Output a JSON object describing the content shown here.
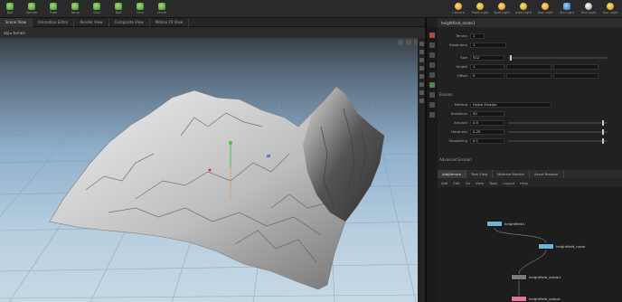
{
  "shelf": {
    "tools": [
      {
        "label": "Box",
        "icon": "box-icon",
        "color": "green"
      },
      {
        "label": "Sphere",
        "icon": "sphere-icon",
        "color": "green"
      },
      {
        "label": "Tube",
        "icon": "tube-icon",
        "color": "green"
      },
      {
        "label": "Torus",
        "icon": "torus-icon",
        "color": "green"
      },
      {
        "label": "Grid",
        "icon": "grid-icon",
        "color": "green"
      },
      {
        "label": "Null",
        "icon": "null-icon",
        "color": "green"
      },
      {
        "label": "Line",
        "icon": "line-icon",
        "color": "green"
      },
      {
        "label": "Circle",
        "icon": "circle-icon",
        "color": "green"
      }
    ],
    "right_tools": [
      {
        "label": "Camera",
        "icon": "camera-icon",
        "color": "yellow"
      },
      {
        "label": "Point Light",
        "icon": "point-light-icon",
        "color": "yellow"
      },
      {
        "label": "Spot Light",
        "icon": "spot-light-icon",
        "color": "yellow"
      },
      {
        "label": "Area Light",
        "icon": "area-light-icon",
        "color": "yellow"
      },
      {
        "label": "Geo Light",
        "icon": "geo-light-icon",
        "color": "yellow"
      },
      {
        "label": "Sky Light",
        "icon": "sky-light-icon",
        "color": "blue"
      },
      {
        "label": "Env Light",
        "icon": "env-light-icon",
        "color": "white"
      },
      {
        "label": "Sun Light",
        "icon": "sun-light-icon",
        "color": "yellow"
      }
    ]
  },
  "tabs": [
    "Scene View",
    "Animation Editor",
    "Render View",
    "Composite View",
    "Motion FX View"
  ],
  "viewport": {
    "crumb": "obj ▸ terrain",
    "colors": {
      "sky_top": "#2f3236",
      "sky_mid": "#8fb0cc",
      "grid": "#7d9ab3"
    }
  },
  "panel": {
    "header": "heightfield_erode1",
    "fields": [
      {
        "label": "Terrain",
        "value": "1"
      },
      {
        "label": "Resolution",
        "value": "1"
      },
      {
        "label": "Size",
        "value": "512"
      },
      {
        "label": "Height",
        "value": "1"
      },
      {
        "label": "Offset",
        "value": "0"
      }
    ],
    "group": "Erosion",
    "erosion_fields": [
      {
        "label": "Method",
        "value": "Hydro Erosion"
      },
      {
        "label": "Iterations",
        "value": "50"
      },
      {
        "label": "Amount",
        "value": "0.5"
      },
      {
        "label": "Hardness",
        "value": "0.25"
      },
      {
        "label": "Smoothing",
        "value": "0.1"
      }
    ],
    "footer_label": "Advanced Erosion"
  },
  "network": {
    "tabs": [
      "/obj/terrain",
      "Tree View",
      "Material Palette",
      "Asset Browser"
    ],
    "toolbar": [
      "Add",
      "Edit",
      "Go",
      "View",
      "Tools",
      "Layout",
      "Help"
    ],
    "nodes": [
      {
        "label": "heightfield1",
        "color": "#6fb4d8"
      },
      {
        "label": "heightfield_noise",
        "color": "#6fb4d8"
      },
      {
        "label": "heightfield_erode1",
        "color": "#7a7a7a"
      },
      {
        "label": "heightfield_output",
        "color": "#d9789a"
      }
    ]
  }
}
